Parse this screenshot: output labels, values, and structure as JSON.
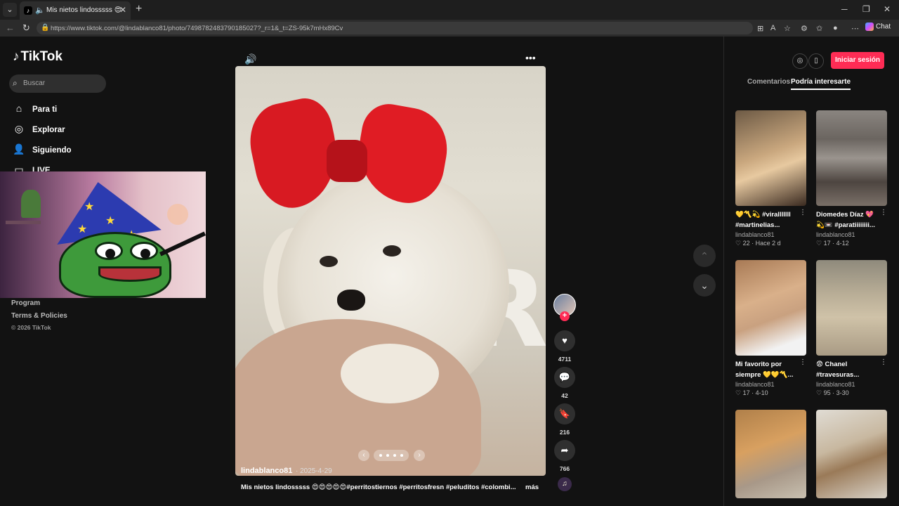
{
  "browser": {
    "tab_title": "Mis nietos lindosssss 😍😍😍",
    "url": "https://www.tiktok.com/@lindablanco81/photo/7498782483790185027?_r=1&_t=ZS-95k7mHx89Cv",
    "chat_label": "Chat"
  },
  "sidebar": {
    "logo": "TikTok",
    "search_placeholder": "Buscar",
    "items": [
      {
        "label": "Para ti",
        "icon": "home-icon"
      },
      {
        "label": "Explorar",
        "icon": "compass-icon"
      },
      {
        "label": "Siguiendo",
        "icon": "user-follow-icon"
      },
      {
        "label": "LIVE",
        "icon": "live-icon"
      }
    ],
    "footer": {
      "program": "Program",
      "terms": "Terms & Policies",
      "copyright": "© 2026 TikTok"
    }
  },
  "post": {
    "author": "lindablanco81",
    "date": "· 2025-4-29",
    "caption": "Mis nietos lindosssss 😍😍😍😍😍#perritostiernos #perritosfresn #peluditos #colombi...",
    "more": "más",
    "likes": "4711",
    "comments": "42",
    "saves": "216",
    "shares": "766"
  },
  "right_panel": {
    "login_label": "Iniciar sesión",
    "tabs": [
      "Comentarios",
      "Podría interesarte"
    ],
    "cards": [
      {
        "title": "💛〽️💫 #viralllllll #martinelias...",
        "author": "lindablanco81",
        "likes": "22",
        "time": "Hace 2 d"
      },
      {
        "title": "Diomedes Díaz 💖💫📼 #paratiiiiiiii...",
        "author": "lindablanco81",
        "likes": "17",
        "time": "4-12"
      },
      {
        "title": "Mi favorito por siempre 💛💛〽️...",
        "author": "lindablanco81",
        "likes": "17",
        "time": "4-10"
      },
      {
        "title": "😨 Chanel #travesuras...",
        "author": "lindablanco81",
        "likes": "95",
        "time": "3-30"
      }
    ]
  }
}
